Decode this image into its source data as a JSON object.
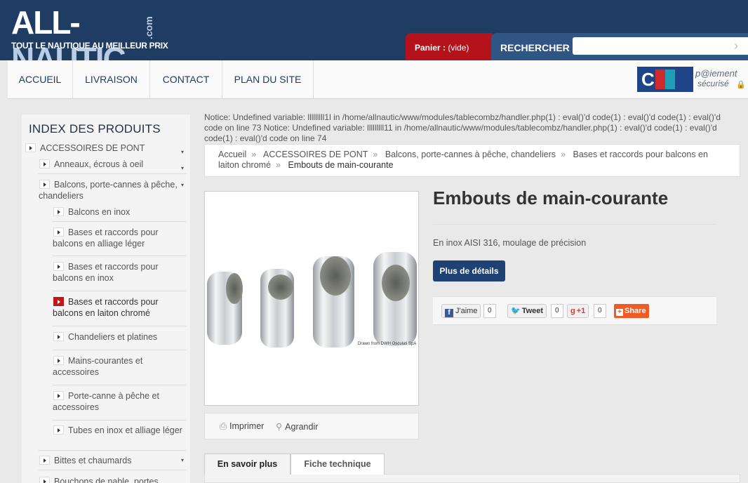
{
  "header": {
    "logo_white": "ALL-",
    "logo_blue": "NAUTIC",
    "logo_com": ".com",
    "tagline": "TOUT LE NAUTIQUE AU MEILLEUR PRIX",
    "cart_label": "Panier :",
    "cart_value": "(vide)",
    "search_label": "RECHERCHER",
    "search_value": ""
  },
  "nav": {
    "items": [
      "ACCUEIL",
      "LIVRAISON",
      "CONTACT",
      "PLAN DU SITE"
    ],
    "payment_logo": "CIC",
    "payment_line1": "p@iement",
    "payment_line2": "sécurisé"
  },
  "sidebar": {
    "title": "INDEX DES PRODUITS",
    "items": [
      "ACCESSOIRES DE PONT",
      "Anneaux, écrous à oeil",
      "Balcons, porte-cannes à pêche, chandeliers",
      "Balcons en inox",
      "Bases et raccords pour balcons en alliage léger",
      "Bases et raccords pour balcons en inox",
      "Bases et raccords pour balcons en laiton chromé",
      "Chandeliers et platines",
      "Mains-courantes et accessoires",
      "Porte-canne à pêche et accessoires",
      "Tubes en inox et alliage léger",
      "Bittes et chaumards",
      "Bouchons de nable, portes"
    ]
  },
  "notice": "Notice: Undefined variable: lllllllll1l in /home/allnautic/www/modules/tablecombz/handler.php(1) : eval()'d code(1) : eval()'d code(1) : eval()'d code on line 73 Notice: Undefined variable: lllllllll11 in /home/allnautic/www/modules/tablecombz/handler.php(1) : eval()'d code(1) : eval()'d code(1) : eval()'d code on line 74",
  "breadcrumb": {
    "items": [
      "Accueil",
      "ACCESSOIRES DE PONT",
      "Balcons, porte-cannes à pêche, chandeliers",
      "Bases et raccords pour balcons en laiton chromé"
    ],
    "current": "Embouts de main-courante"
  },
  "product": {
    "title": "Embouts de main-courante",
    "description": "En inox AISI 316, moulage de précision",
    "details_button": "Plus de détails",
    "image_caption": "Drawn from DWH Osculati SpA",
    "print_label": "Imprimer",
    "zoom_label": "Agrandir"
  },
  "social": {
    "facebook_label": "J'aime",
    "facebook_count": "0",
    "twitter_label": "Tweet",
    "twitter_count": "0",
    "gplus_label": "+1",
    "gplus_count": "0",
    "share_label": "Share"
  },
  "tabs": [
    "En savoir plus",
    "Fiche technique"
  ]
}
